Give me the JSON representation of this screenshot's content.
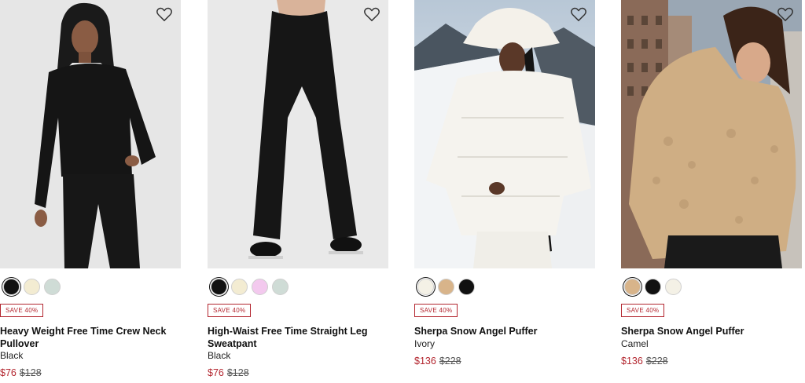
{
  "products": [
    {
      "name": "Heavy Weight Free Time Crew Neck Pullover",
      "color": "Black",
      "badge": "SAVE 40%",
      "sale_price": "$76",
      "original_price": "$128",
      "swatches": [
        {
          "name": "black",
          "hex": "#111111",
          "selected": true
        },
        {
          "name": "cream",
          "hex": "#f3ecd2",
          "selected": false
        },
        {
          "name": "sage",
          "hex": "#cfdcd6",
          "selected": false
        }
      ],
      "image_subject": "model-black-crew-neck-pullover"
    },
    {
      "name": "High-Waist Free Time Straight Leg Sweatpant",
      "color": "Black",
      "badge": "SAVE 40%",
      "sale_price": "$76",
      "original_price": "$128",
      "swatches": [
        {
          "name": "black",
          "hex": "#111111",
          "selected": true
        },
        {
          "name": "cream",
          "hex": "#f3ecd2",
          "selected": false
        },
        {
          "name": "pink",
          "hex": "#f3c9ee",
          "selected": false
        },
        {
          "name": "sage",
          "hex": "#cfdcd6",
          "selected": false
        }
      ],
      "image_subject": "model-black-straight-leg-sweatpant"
    },
    {
      "name": "Sherpa Snow Angel Puffer",
      "color": "Ivory",
      "badge": "SAVE 40%",
      "sale_price": "$136",
      "original_price": "$228",
      "swatches": [
        {
          "name": "ivory",
          "hex": "#f4f1e6",
          "selected": true
        },
        {
          "name": "camel",
          "hex": "#d8b48a",
          "selected": false
        },
        {
          "name": "black",
          "hex": "#111111",
          "selected": false
        }
      ],
      "image_subject": "model-ivory-sherpa-puffer-snow"
    },
    {
      "name": "Sherpa Snow Angel Puffer",
      "color": "Camel",
      "badge": "SAVE 40%",
      "sale_price": "$136",
      "original_price": "$228",
      "swatches": [
        {
          "name": "camel",
          "hex": "#d8b48a",
          "selected": true
        },
        {
          "name": "black",
          "hex": "#111111",
          "selected": false
        },
        {
          "name": "ivory",
          "hex": "#f4f1e6",
          "selected": false
        }
      ],
      "image_subject": "model-camel-sherpa-puffer-city"
    }
  ],
  "icons": {
    "favorite": "heart-outline-icon"
  },
  "colors": {
    "sale_red": "#b3262f",
    "text": "#111111"
  }
}
